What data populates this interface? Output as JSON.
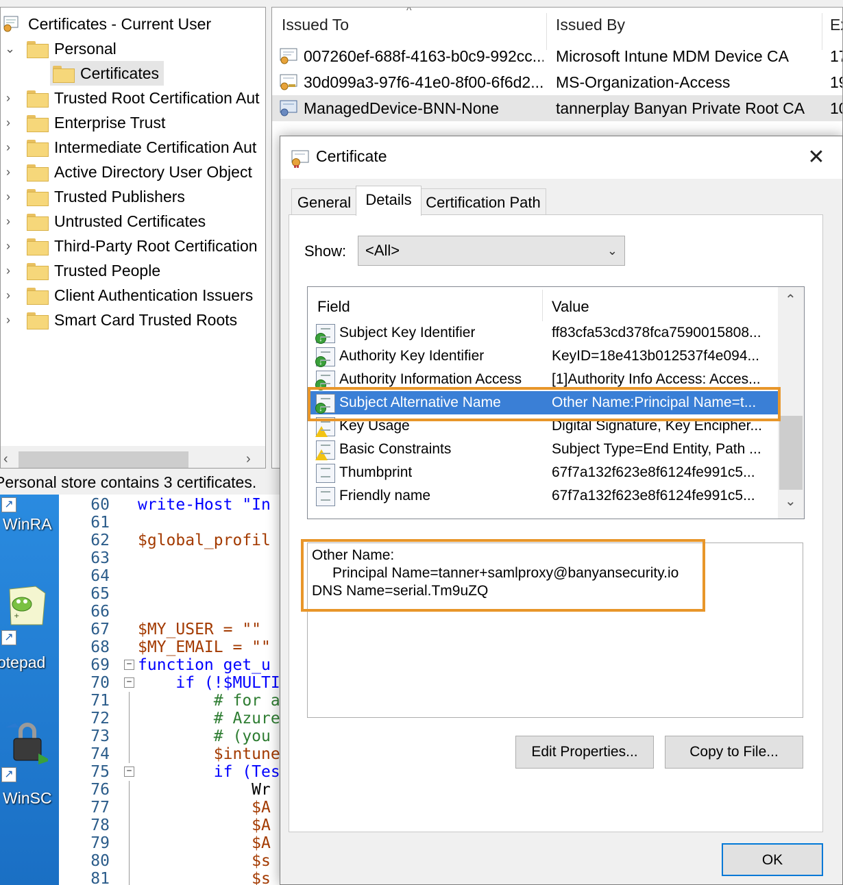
{
  "tree": {
    "root_label": "Certificates - Current User",
    "items": [
      {
        "label": "Personal",
        "expanded": true
      },
      {
        "label": "Certificates",
        "selected": true
      },
      {
        "label": "Trusted Root Certification Aut"
      },
      {
        "label": "Enterprise Trust"
      },
      {
        "label": "Intermediate Certification Aut"
      },
      {
        "label": "Active Directory User Object"
      },
      {
        "label": "Trusted Publishers"
      },
      {
        "label": "Untrusted Certificates"
      },
      {
        "label": "Third-Party Root Certification"
      },
      {
        "label": "Trusted People"
      },
      {
        "label": "Client Authentication Issuers"
      },
      {
        "label": "Smart Card Trusted Roots"
      }
    ]
  },
  "status": {
    "text": "Personal store contains 3 certificates."
  },
  "list": {
    "columns": [
      "Issued To",
      "Issued By",
      "Ex"
    ],
    "rows": [
      {
        "issued_to": "007260ef-688f-4163-b0c9-992cc...",
        "issued_by": "Microsoft Intune MDM Device CA",
        "exp": "17"
      },
      {
        "issued_to": "30d099a3-97f6-41e0-8f00-6f6d2...",
        "issued_by": "MS-Organization-Access",
        "exp": "19"
      },
      {
        "issued_to": "ManagedDevice-BNN-None",
        "issued_by": "tannerplay Banyan Private Root CA",
        "exp": "10",
        "selected": true
      }
    ]
  },
  "desktop": {
    "icons": [
      {
        "label": "WinRA",
        "icon": "winrar-icon"
      },
      {
        "label": "otepad",
        "icon": "notepad-plus-plus-icon"
      },
      {
        "label": "WinSC",
        "icon": "winscp-icon"
      }
    ]
  },
  "editor": {
    "lines": [
      {
        "n": "60",
        "text": "write-Host \"In"
      },
      {
        "n": "61",
        "text": ""
      },
      {
        "n": "62",
        "text": "$global_profil"
      },
      {
        "n": "63",
        "text": ""
      },
      {
        "n": "64",
        "text": ""
      },
      {
        "n": "65",
        "text": ""
      },
      {
        "n": "66",
        "text": ""
      },
      {
        "n": "67",
        "text": "$MY_USER = \"\""
      },
      {
        "n": "68",
        "text": "$MY_EMAIL = \"\""
      },
      {
        "n": "69",
        "text": "function get_u"
      },
      {
        "n": "70",
        "text": "    if (!$MULTI"
      },
      {
        "n": "71",
        "text": "        # for a"
      },
      {
        "n": "72",
        "text": "        # Azure"
      },
      {
        "n": "73",
        "text": "        # (you"
      },
      {
        "n": "74",
        "text": "        $intune"
      },
      {
        "n": "75",
        "text": "        if (Tes"
      },
      {
        "n": "76",
        "text": "            Wr"
      },
      {
        "n": "77",
        "text": "            $A"
      },
      {
        "n": "78",
        "text": "            $A"
      },
      {
        "n": "79",
        "text": "            $A"
      },
      {
        "n": "80",
        "text": "            $s"
      },
      {
        "n": "81",
        "text": "            $s"
      }
    ]
  },
  "dialog": {
    "title": "Certificate",
    "close_glyph": "✕",
    "tabs": [
      "General",
      "Details",
      "Certification Path"
    ],
    "active_tab": "Details",
    "show_label": "Show:",
    "show_value": "<All>",
    "fields_header": {
      "field": "Field",
      "value": "Value"
    },
    "fields": [
      {
        "name": "Subject Key Identifier",
        "value": "ff83cfa53cd378fca7590015808...",
        "icon": "extension-icon"
      },
      {
        "name": "Authority Key Identifier",
        "value": "KeyID=18e413b012537f4e094...",
        "icon": "extension-icon"
      },
      {
        "name": "Authority Information Access",
        "value": "[1]Authority Info Access: Acces...",
        "icon": "extension-icon"
      },
      {
        "name": "Subject Alternative Name",
        "value": "Other Name:Principal Name=t...",
        "icon": "extension-icon",
        "selected": true
      },
      {
        "name": "Key Usage",
        "value": "Digital Signature, Key Encipher...",
        "icon": "critical-extension-icon"
      },
      {
        "name": "Basic Constraints",
        "value": "Subject Type=End Entity, Path ...",
        "icon": "critical-extension-icon"
      },
      {
        "name": "Thumbprint",
        "value": "67f7a132f623e8f6124fe991c5...",
        "icon": "property-icon"
      },
      {
        "name": "Friendly name",
        "value": "67f7a132f623e8f6124fe991c5...",
        "icon": "property-icon"
      }
    ],
    "value_text": {
      "line1": "Other Name:",
      "line2": "Principal Name=tanner+samlproxy@banyansecurity.io",
      "line3": "DNS Name=serial.Tm9uZQ"
    },
    "buttons": {
      "edit": "Edit Properties...",
      "copy": "Copy to File...",
      "ok": "OK"
    },
    "highlight_color": "#e8962a",
    "selection_color": "#3a7fd6"
  }
}
